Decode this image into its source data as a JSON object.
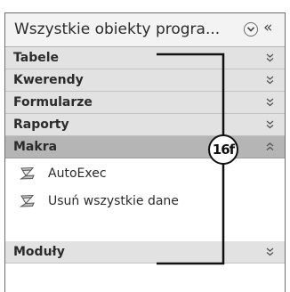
{
  "navigation_pane": {
    "title": "Wszystkie obiekty progra...",
    "collapse_glyph": "«",
    "groups": [
      {
        "label": "Tabele",
        "state": "collapsed"
      },
      {
        "label": "Kwerendy",
        "state": "collapsed"
      },
      {
        "label": "Formularze",
        "state": "collapsed"
      },
      {
        "label": "Raporty",
        "state": "collapsed"
      },
      {
        "label": "Makra",
        "state": "expanded"
      },
      {
        "label": "Moduły",
        "state": "collapsed"
      }
    ],
    "macro_items": [
      {
        "label": "AutoExec",
        "icon": "macro-icon"
      },
      {
        "label": "Usuń wszystkie dane",
        "icon": "macro-icon"
      }
    ]
  },
  "callout": {
    "label": "16f"
  },
  "colors": {
    "header_bg": "#f3f3f3",
    "group_bg": "#e2e2e2",
    "group_active_bg": "#b5b5b5",
    "border": "#6e6e6e",
    "callout_line": "#111111"
  }
}
